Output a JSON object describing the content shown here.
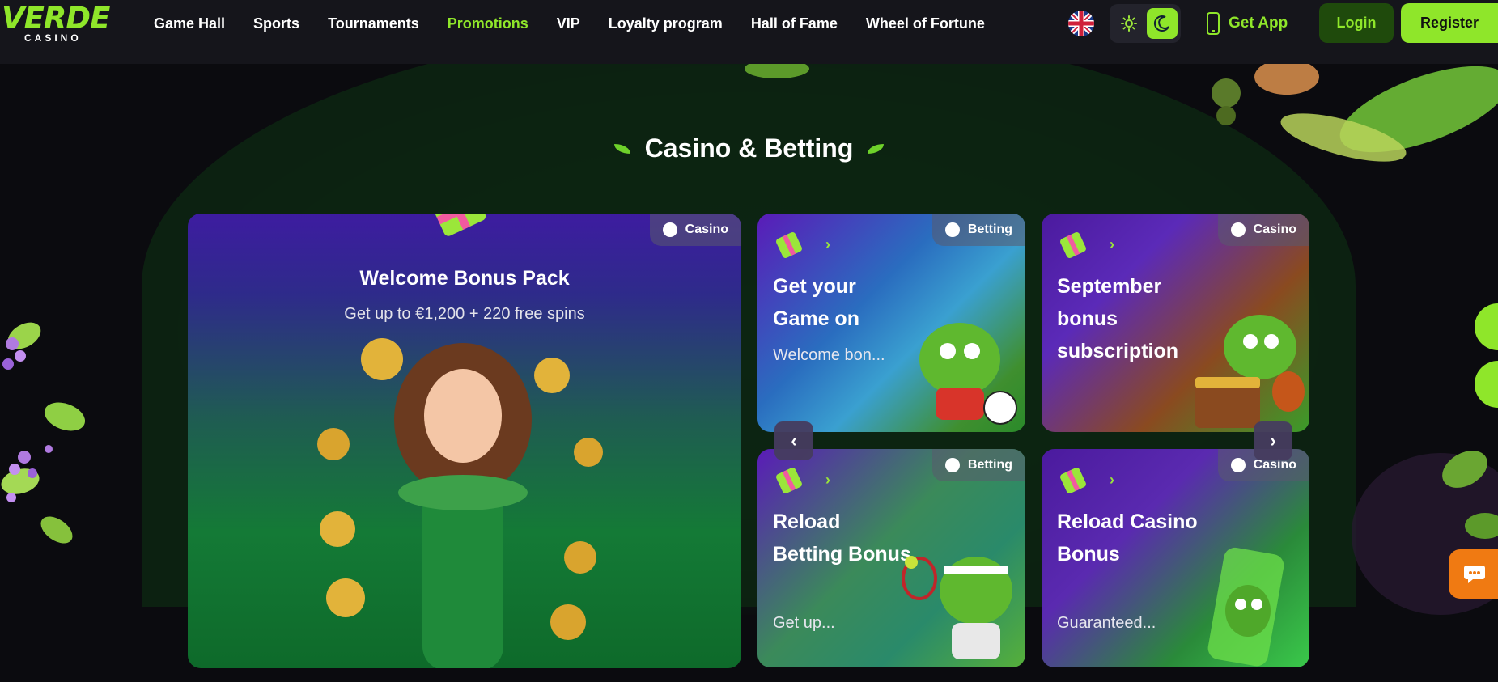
{
  "logo": {
    "main": "VERDE",
    "sub": "CASINO"
  },
  "nav": [
    {
      "label": "Game Hall",
      "active": false
    },
    {
      "label": "Sports",
      "active": false
    },
    {
      "label": "Tournaments",
      "active": false
    },
    {
      "label": "Promotions",
      "active": true
    },
    {
      "label": "VIP",
      "active": false
    },
    {
      "label": "Loyalty program",
      "active": false
    },
    {
      "label": "Hall of Fame",
      "active": false
    },
    {
      "label": "Wheel of Fortune",
      "active": false
    }
  ],
  "header": {
    "language_icon": "uk-flag-icon",
    "theme_light_icon": "sun-icon",
    "theme_dark_icon": "moon-icon",
    "get_app_label": "Get App",
    "login_label": "Login",
    "register_label": "Register"
  },
  "section": {
    "title": "Casino & Betting"
  },
  "featured": {
    "badge": "Casino",
    "title": "Welcome Bonus Pack",
    "subtitle": "Get up to €1,200 + 220 free spins"
  },
  "promos": [
    {
      "badge": "Betting",
      "title": "Get your Game on",
      "desc": "Welcome bon..."
    },
    {
      "badge": "Casino",
      "title": "September bonus subscription",
      "desc": ""
    },
    {
      "badge": "Betting",
      "title": "Reload Betting Bonus",
      "desc": "Get up..."
    },
    {
      "badge": "Casino",
      "title": "Reload Casino Bonus",
      "desc": "Guaranteed..."
    }
  ],
  "colors": {
    "accent": "#8fe62a",
    "header_bg": "#15151b",
    "page_bg": "#0b0b0f",
    "chat": "#f07a12"
  }
}
